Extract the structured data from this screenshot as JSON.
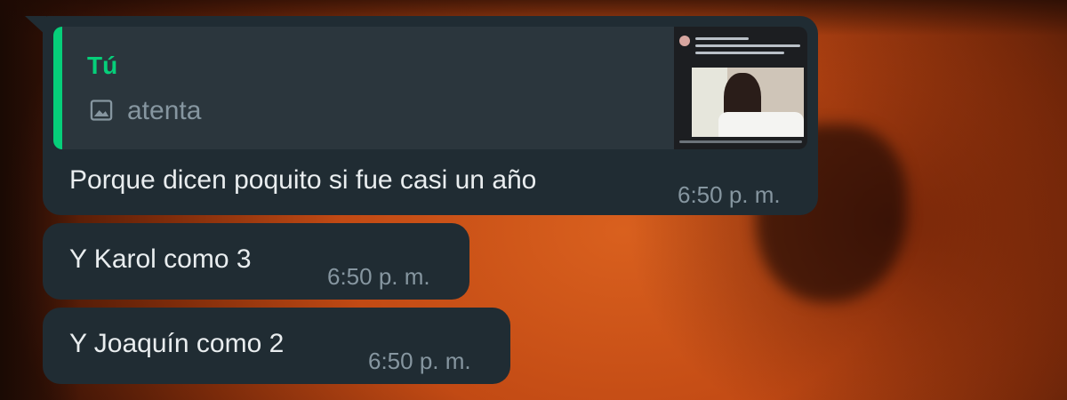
{
  "messages": [
    {
      "reply_to": {
        "author": "Tú",
        "icon": "image-icon",
        "text": "atenta"
      },
      "text": "Porque dicen poquito si fue casi un año",
      "time": "6:50 p. m."
    },
    {
      "text": "Y Karol como 3",
      "time": "6:50 p. m."
    },
    {
      "text": "Y Joaquín como 2",
      "time": "6:50 p. m."
    }
  ],
  "colors": {
    "bubble": "#202c33",
    "quote_background": "#2b363d",
    "quote_accent": "#06cf7a",
    "text_primary": "#e9edef",
    "text_secondary": "#8696a0"
  }
}
